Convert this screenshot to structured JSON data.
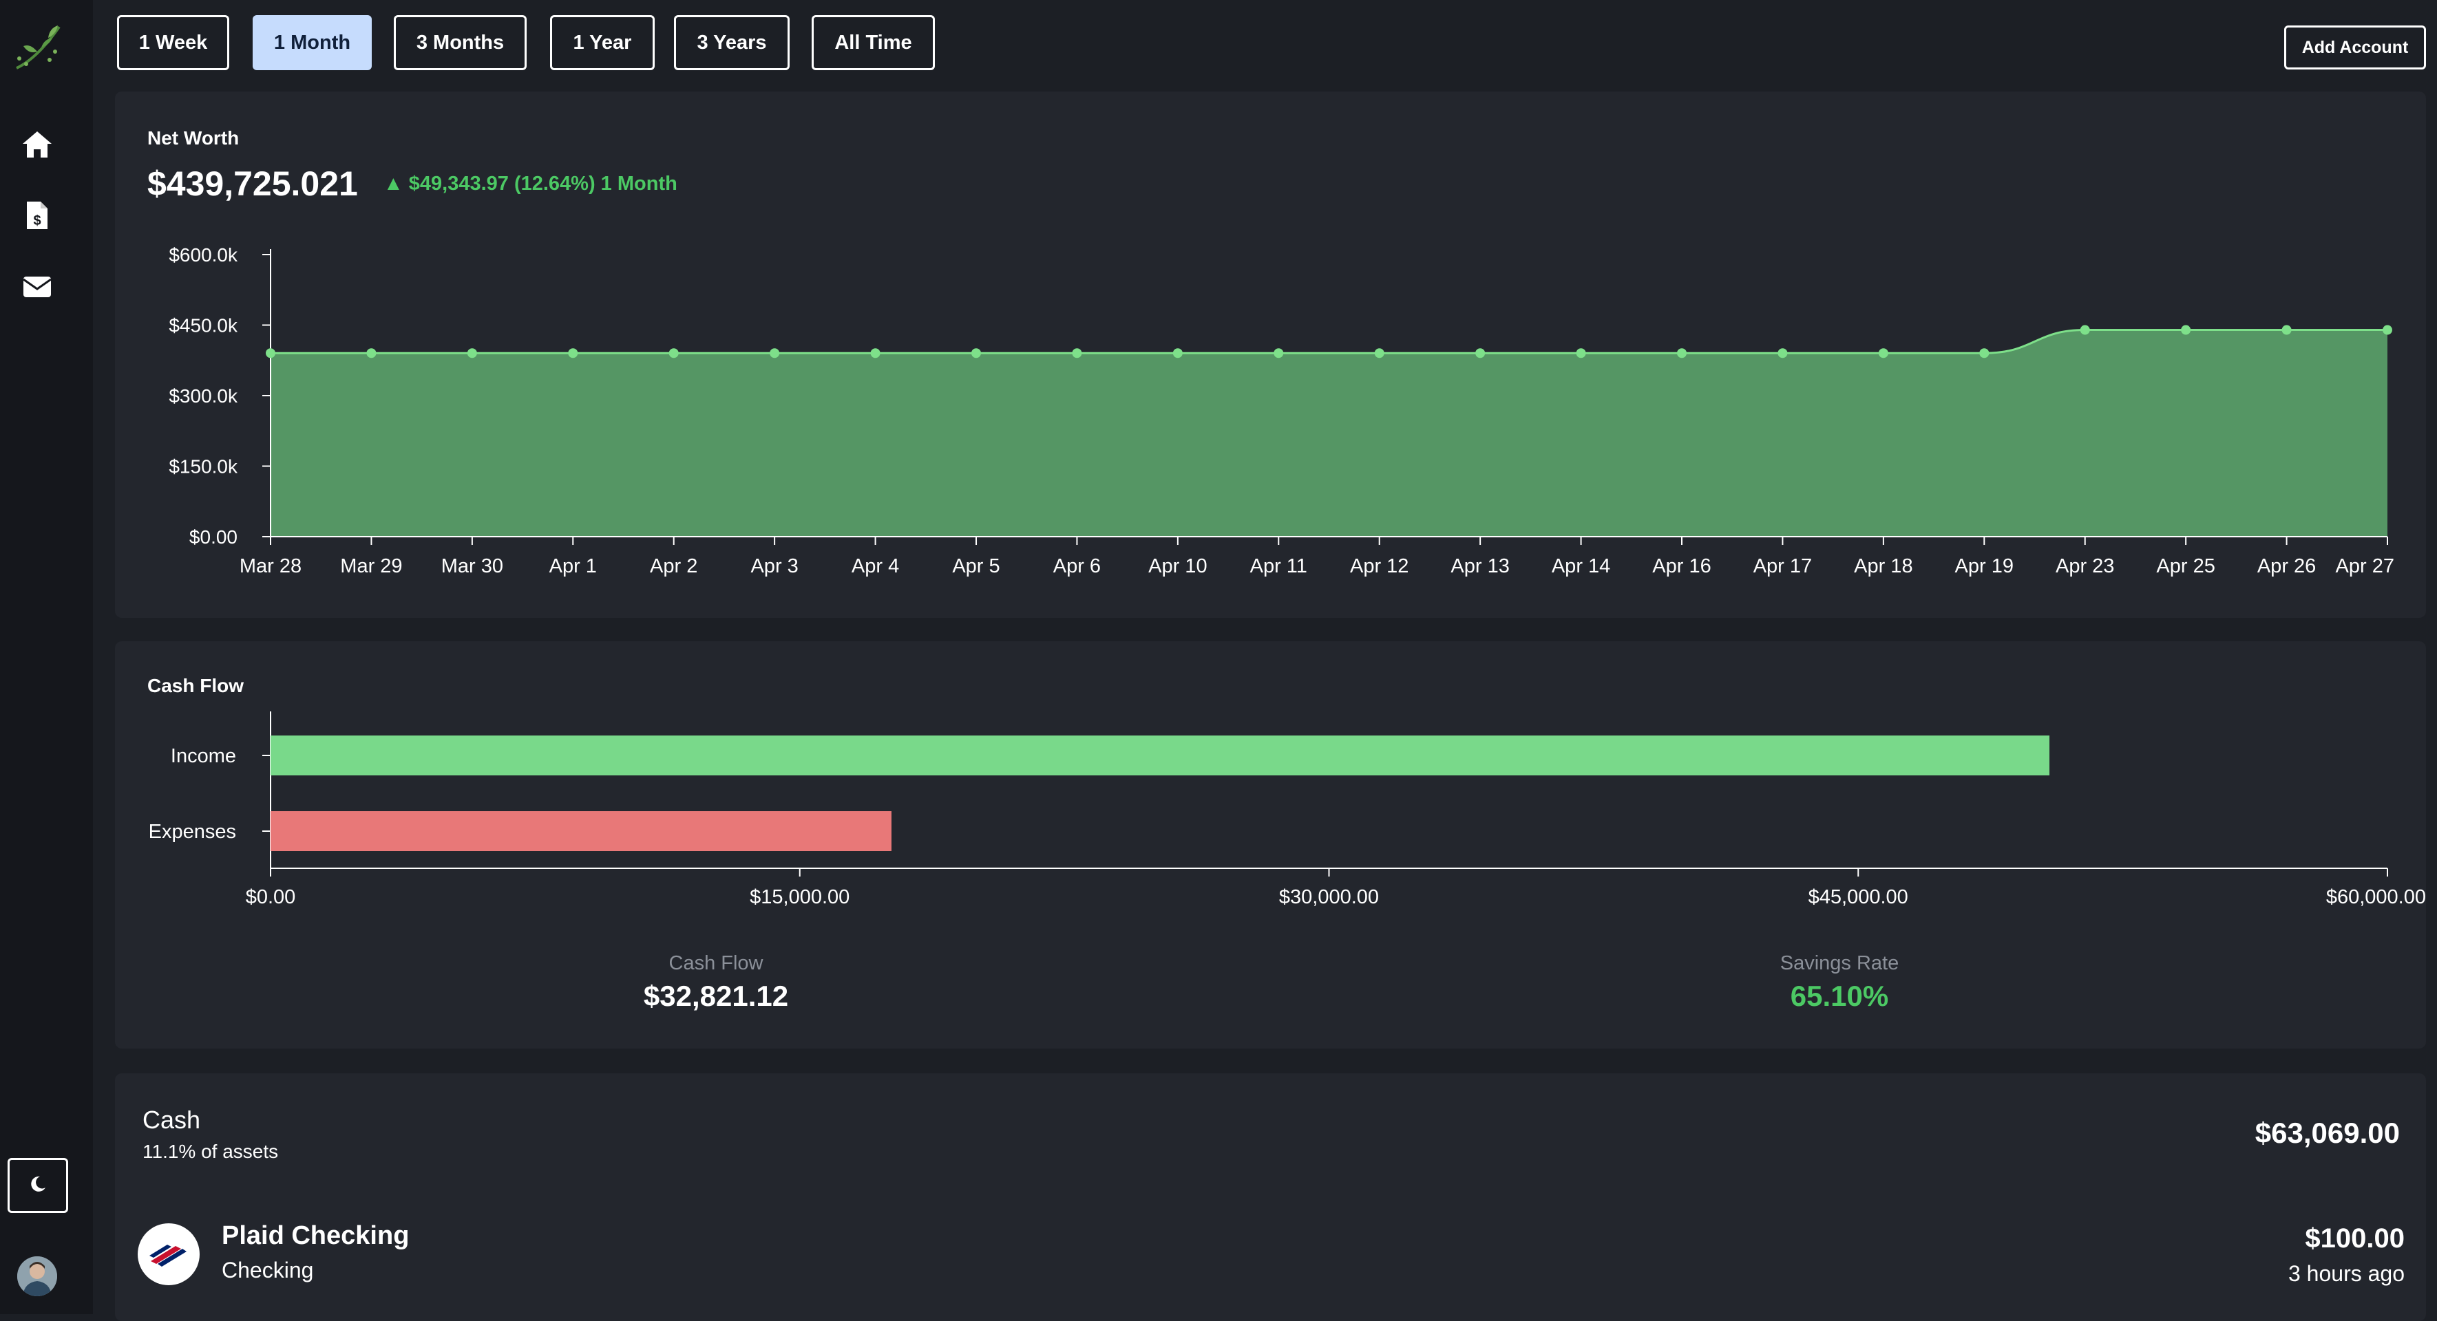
{
  "app": {
    "nav": [
      {
        "name": "home",
        "icon": "home-icon"
      },
      {
        "name": "bills",
        "icon": "invoice-dollar-icon"
      },
      {
        "name": "messages",
        "icon": "envelope-icon"
      }
    ],
    "logo_icon": "plant-leaf-icon",
    "theme_icon": "moon-icon"
  },
  "toolbar": {
    "ranges": [
      "1 Week",
      "1 Month",
      "3 Months",
      "1 Year",
      "3 Years",
      "All Time"
    ],
    "active_range": "1 Month",
    "add_account_label": "Add Account"
  },
  "net_worth": {
    "title": "Net Worth",
    "value": "$439,725.021",
    "change": "▲ $49,343.97 (12.64%) 1 Month"
  },
  "cash_flow": {
    "title": "Cash Flow",
    "cash_flow_label": "Cash Flow",
    "cash_flow_value": "$32,821.12",
    "savings_rate_label": "Savings Rate",
    "savings_rate_value": "65.10%"
  },
  "cash": {
    "title": "Cash",
    "pct_assets": "11.1% of assets",
    "total": "$63,069.00",
    "account": {
      "name": "Plaid Checking",
      "type": "Checking",
      "balance": "$100.00",
      "updated": "3 hours ago"
    }
  },
  "colors": {
    "accent_green": "#4cc964",
    "area_fill": "#559664",
    "income_bar": "#79d98a",
    "expenses_bar": "#e87878",
    "active_tab": "#c6dcfd"
  },
  "chart_data": [
    {
      "type": "area",
      "x": [
        "Mar 28",
        "Mar 29",
        "Mar 30",
        "Apr 1",
        "Apr 2",
        "Apr 3",
        "Apr 4",
        "Apr 5",
        "Apr 6",
        "Apr 10",
        "Apr 11",
        "Apr 12",
        "Apr 13",
        "Apr 14",
        "Apr 16",
        "Apr 17",
        "Apr 18",
        "Apr 19",
        "Apr 23",
        "Apr 25",
        "Apr 26",
        "Apr 27"
      ],
      "values": [
        390381,
        390381,
        390381,
        390381,
        390381,
        390381,
        390381,
        390381,
        390381,
        390381,
        390381,
        390381,
        390381,
        390381,
        390381,
        390381,
        390381,
        390381,
        439725,
        439725,
        439725,
        439725
      ],
      "ylim": [
        0,
        600000
      ],
      "yticks": [
        0,
        150000,
        300000,
        450000,
        600000
      ],
      "ytick_labels": [
        "$0.00",
        "$150.0k",
        "$300.0k",
        "$450.0k",
        "$600.0k"
      ],
      "grid": false
    },
    {
      "type": "bar",
      "orientation": "horizontal",
      "categories": [
        "Income",
        "Expenses"
      ],
      "values": [
        50420,
        17599
      ],
      "xlim": [
        0,
        60000
      ],
      "xticks": [
        0,
        15000,
        30000,
        45000,
        60000
      ],
      "xtick_labels": [
        "$0.00",
        "$15,000.00",
        "$30,000.00",
        "$45,000.00",
        "$60,000.00"
      ],
      "grid": false
    }
  ]
}
